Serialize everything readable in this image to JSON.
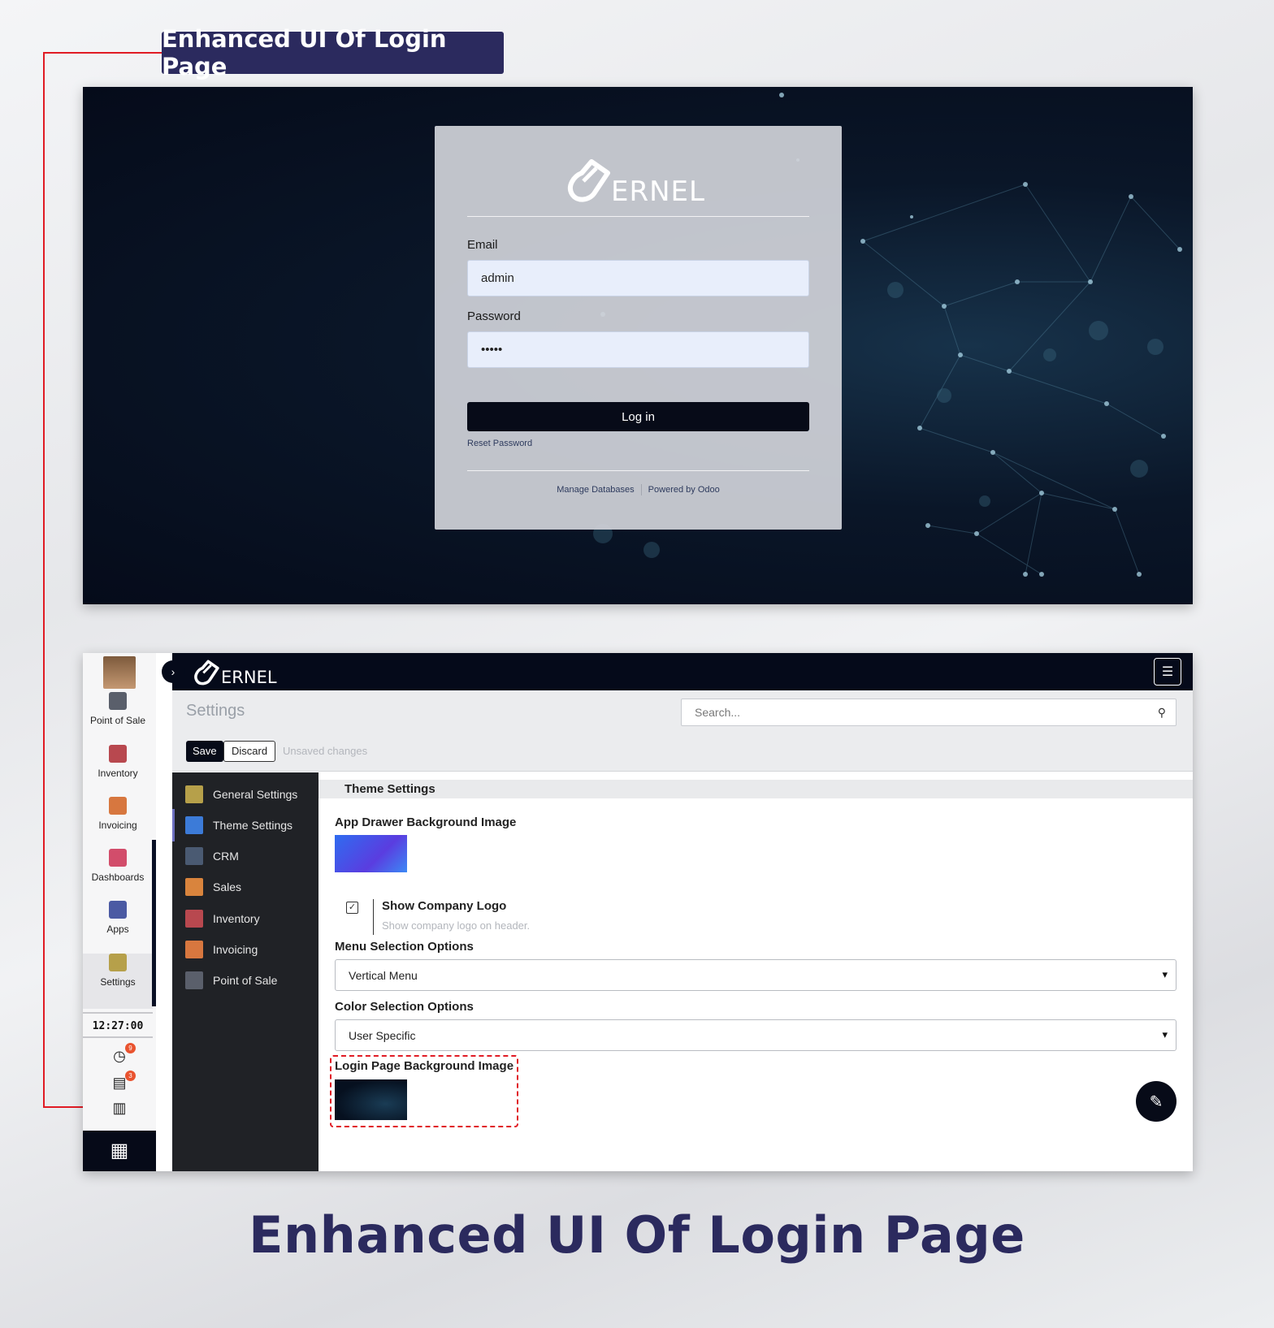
{
  "callout": {
    "badge_label": "Enhanced UI Of Login Page"
  },
  "login_page": {
    "logo_text": "ERNEL",
    "email_label": "Email",
    "email_value": "admin",
    "password_label": "Password",
    "password_value": "•••••",
    "login_button": "Log in",
    "reset_password": "Reset Password",
    "manage_databases": "Manage Databases",
    "powered_by": "Powered by Odoo"
  },
  "settings_page": {
    "logo_text": "ERNEL",
    "vertical_menu": [
      {
        "label": "Point of Sale",
        "icon": "point-of-sale-icon",
        "color": "#5a5f6b"
      },
      {
        "label": "Inventory",
        "icon": "inventory-icon",
        "color": "#b8484f"
      },
      {
        "label": "Invoicing",
        "icon": "invoicing-icon",
        "color": "#d7773f"
      },
      {
        "label": "Dashboards",
        "icon": "dashboards-icon",
        "color": "#d24d6b"
      },
      {
        "label": "Apps",
        "icon": "apps-icon",
        "color": "#4b5aa3"
      },
      {
        "label": "Settings",
        "icon": "settings-icon",
        "color": "#b6a04a"
      }
    ],
    "clock": "12:27:00",
    "activity_count": "9",
    "message_count": "3",
    "title": "Settings",
    "search_placeholder": "Search...",
    "save_label": "Save",
    "discard_label": "Discard",
    "unsaved_label": "Unsaved changes",
    "nav_items": [
      {
        "label": "General Settings",
        "color": "#b6a04a"
      },
      {
        "label": "Theme Settings",
        "color": "#3c7bd8"
      },
      {
        "label": "CRM",
        "color": "#4a5a72"
      },
      {
        "label": "Sales",
        "color": "#d9843d"
      },
      {
        "label": "Inventory",
        "color": "#b8484f"
      },
      {
        "label": "Invoicing",
        "color": "#d7773f"
      },
      {
        "label": "Point of Sale",
        "color": "#5a5f6b"
      }
    ],
    "section_title": "Theme Settings",
    "app_drawer_label": "App Drawer Background Image",
    "show_logo_label": "Show Company Logo",
    "show_logo_desc": "Show company logo on header.",
    "show_logo_checked": true,
    "menu_selection_label": "Menu Selection Options",
    "menu_selection_value": "Vertical Menu",
    "color_selection_label": "Color Selection Options",
    "color_selection_value": "User Specific",
    "login_bg_label": "Login Page Background Image"
  },
  "footer": {
    "title": "Enhanced UI Of Login Page"
  },
  "colors": {
    "brand_navy": "#2b2a5e",
    "accent_red": "#e01b24",
    "dark": "#050a1a"
  }
}
